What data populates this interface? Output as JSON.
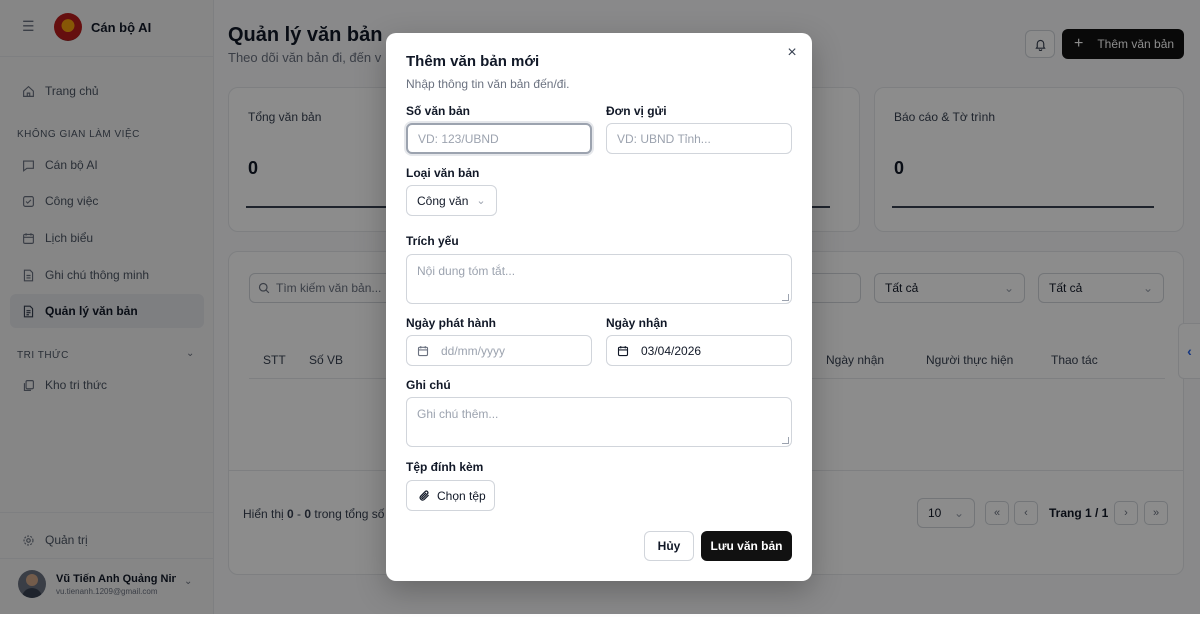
{
  "sidebar": {
    "brand": "Cán bộ AI",
    "home": "Trang chủ",
    "workspace_heading": "KHÔNG GIAN LÀM VIỆC",
    "items": [
      {
        "label": "Cán bộ AI",
        "icon": "chat-icon"
      },
      {
        "label": "Công việc",
        "icon": "checkbox-icon"
      },
      {
        "label": "Lịch biểu",
        "icon": "calendar-icon"
      },
      {
        "label": "Ghi chú thông minh",
        "icon": "note-icon"
      },
      {
        "label": "Quản lý văn bản",
        "icon": "document-icon",
        "active": true
      }
    ],
    "knowledge_heading": "TRI THỨC",
    "knowledge_item": "Kho tri thức",
    "admin": "Quản trị",
    "user": {
      "name": "Vũ Tiến Anh Quảng Nin...",
      "email": "vu.tienanh.1209@gmail.com"
    }
  },
  "header": {
    "title": "Quản lý văn bản",
    "subtitle": "Theo dõi văn bản đi, đến v",
    "add_button": "Thêm văn bản"
  },
  "stats": [
    {
      "label": "Tổng văn bản",
      "value": "0"
    },
    {
      "label": "Báo cáo & Tờ trình",
      "value": "0"
    }
  ],
  "table": {
    "search_placeholder": "Tìm kiếm văn bản...",
    "filter1": "Tất cả",
    "filter2": "Tất cả",
    "columns": {
      "stt": "STT",
      "so_vb": "Số VB",
      "ngay_nhan": "Ngày nhận",
      "nguoi": "Người thực hiện",
      "thao_tac": "Thao tác"
    },
    "footer_prefix": "Hiển thị ",
    "footer_from": "0",
    "footer_sep": " - ",
    "footer_to": "0",
    "footer_suffix": " trong tổng số",
    "page_size": "10",
    "page_info": "Trang 1 / 1"
  },
  "modal": {
    "title": "Thêm văn bản mới",
    "subtitle": "Nhập thông tin văn bản đến/đi.",
    "so_van_ban_label": "Số văn bản",
    "so_van_ban_placeholder": "VD: 123/UBND",
    "don_vi_gui_label": "Đơn vị gửi",
    "don_vi_gui_placeholder": "VD: UBND Tỉnh...",
    "loai_van_ban_label": "Loại văn bản",
    "loai_van_ban_value": "Công văn",
    "trich_yeu_label": "Trích yếu",
    "trich_yeu_placeholder": "Nội dung tóm tắt...",
    "ngay_phat_hanh_label": "Ngày phát hành",
    "ngay_phat_hanh_placeholder": "dd/mm/yyyy",
    "ngay_nhan_label": "Ngày nhận",
    "ngay_nhan_value": "03/04/2026",
    "ghi_chu_label": "Ghi chú",
    "ghi_chu_placeholder": "Ghi chú thêm...",
    "tep_dinh_kem_label": "Tệp đính kèm",
    "chon_tep": "Chọn tệp",
    "cancel": "Hủy",
    "save": "Lưu văn bản"
  }
}
